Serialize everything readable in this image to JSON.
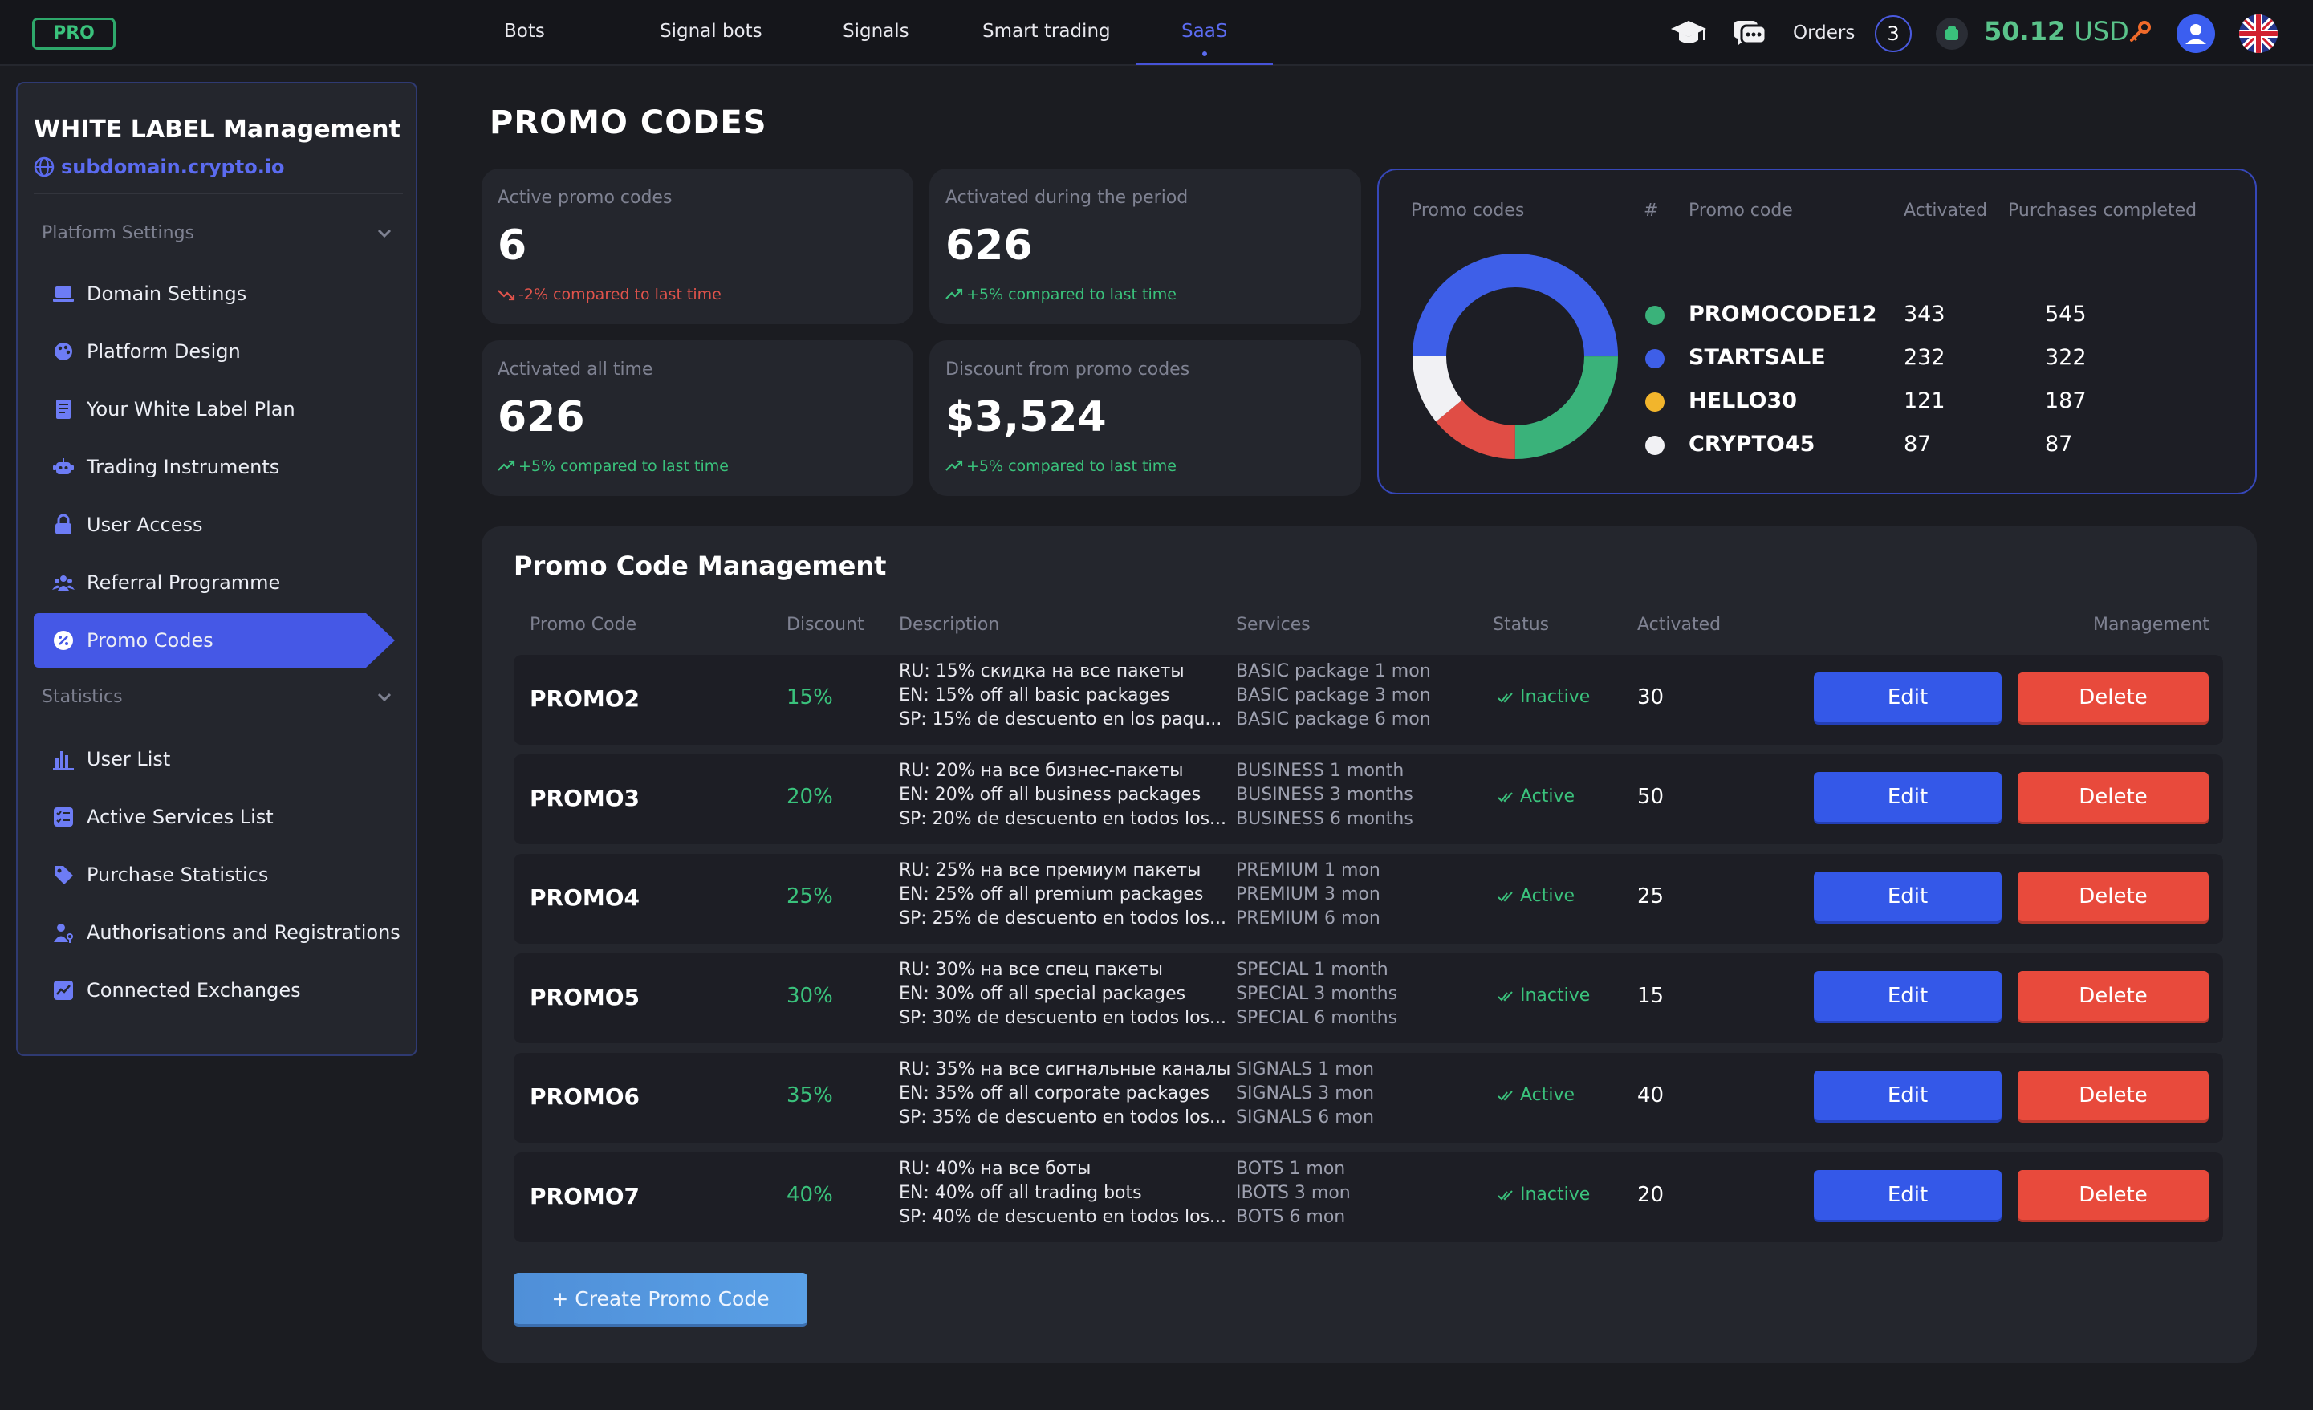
{
  "topbar": {
    "badge": "PRO",
    "nav": [
      {
        "label": "Bots"
      },
      {
        "label": "Signal bots"
      },
      {
        "label": "Signals"
      },
      {
        "label": "Smart trading"
      },
      {
        "label": "SaaS",
        "active": true
      }
    ],
    "orders_label": "Orders",
    "orders_count": "3",
    "balance": "50.12",
    "currency": "USD",
    "icons": [
      "graduation-cap-icon",
      "chat-icon",
      "wallet-icon",
      "key-icon",
      "user-avatar-icon",
      "uk-flag-icon"
    ]
  },
  "sidebar": {
    "title": "WHITE LABEL Management",
    "domain": "subdomain.crypto.io",
    "section_platform": "Platform Settings",
    "platform_items": [
      {
        "label": "Domain Settings",
        "icon": "laptop-icon"
      },
      {
        "label": "Platform Design",
        "icon": "palette-icon"
      },
      {
        "label": "Your White Label Plan",
        "icon": "document-icon"
      },
      {
        "label": "Trading Instruments",
        "icon": "robot-icon"
      },
      {
        "label": "User Access",
        "icon": "lock-icon"
      },
      {
        "label": "Referral Programme",
        "icon": "users-icon"
      },
      {
        "label": "Promo Codes",
        "icon": "percent-icon",
        "active": true
      }
    ],
    "section_stats": "Statistics",
    "stats_items": [
      {
        "label": "User List",
        "icon": "bar-chart-icon"
      },
      {
        "label": "Active Services List",
        "icon": "checklist-icon"
      },
      {
        "label": "Purchase Statistics",
        "icon": "tag-icon"
      },
      {
        "label": "Authorisations and Registrations",
        "icon": "user-key-icon"
      },
      {
        "label": "Connected Exchanges",
        "icon": "trend-icon"
      }
    ]
  },
  "page_title": "PROMO CODES",
  "stats": [
    {
      "label": "Active promo codes",
      "value": "6",
      "compare": "-2% compared to last time",
      "trend": "down"
    },
    {
      "label": "Activated during the period",
      "value": "626",
      "compare": "+5% compared to last time",
      "trend": "up"
    },
    {
      "label": "Activated all time",
      "value": "626",
      "compare": "+5% compared to last time",
      "trend": "up"
    },
    {
      "label": "Discount from promo codes",
      "value": "$3,524",
      "compare": "+5% compared to last time",
      "trend": "up"
    }
  ],
  "promo_summary": {
    "headers": {
      "title": "Promo codes",
      "num": "#",
      "code": "Promo code",
      "activated": "Activated",
      "purchases": "Purchases completed"
    },
    "rows": [
      {
        "name": "PROMOCODE12",
        "activated": "343",
        "purchases": "545",
        "color": "#3ab27a"
      },
      {
        "name": "STARTSALE",
        "activated": "232",
        "purchases": "322",
        "color": "#3e5fe8"
      },
      {
        "name": "HELLO30",
        "activated": "121",
        "purchases": "187",
        "color": "#f2b52c"
      },
      {
        "name": "CRYPTO45",
        "activated": "87",
        "purchases": "87",
        "color": "#f1f1f4"
      }
    ],
    "donut_segments": [
      {
        "color": "#3e5fe8",
        "fraction": 0.5
      },
      {
        "color": "#3ab27a",
        "fraction": 0.25
      },
      {
        "color": "#e04d45",
        "fraction": 0.14
      },
      {
        "color": "#f1f1f4",
        "fraction": 0.11
      }
    ]
  },
  "management": {
    "title": "Promo Code Management",
    "headers": {
      "code": "Promo Code",
      "discount": "Discount",
      "description": "Description",
      "services": "Services",
      "status": "Status",
      "activated": "Activated",
      "management": "Management"
    },
    "edit_label": "Edit",
    "delete_label": "Delete",
    "create_label": "+ Create Promo Code",
    "rows": [
      {
        "code": "PROMO2",
        "discount": "15%",
        "desc": [
          "RU: 15% скидка на все пакеты",
          "EN: 15% off all basic packages",
          "SP: 15% de descuento en  los paqu..."
        ],
        "services": [
          "BASIC package 1 mon",
          "BASIC package 3 mon",
          "BASIC package  6 mon"
        ],
        "status": "Inactive",
        "activated": "30"
      },
      {
        "code": "PROMO3",
        "discount": "20%",
        "desc": [
          "RU: 20%  на все бизнес-пакеты",
          "EN: 20% off all business packages",
          "SP: 20% de descuento en todos los..."
        ],
        "services": [
          "BUSINESS 1 month",
          "BUSINESS 3 months",
          "BUSINESS 6 months"
        ],
        "status": "Active",
        "activated": "50"
      },
      {
        "code": "PROMO4",
        "discount": "25%",
        "desc": [
          "RU: 25%  на все премиум пакеты",
          "EN: 25% off all premium packages",
          "SP: 25% de descuento en todos los..."
        ],
        "services": [
          "PREMIUM 1 mon",
          "PREMIUM 3 mon",
          "PREMIUM 6 mon"
        ],
        "status": "Active",
        "activated": "25"
      },
      {
        "code": "PROMO5",
        "discount": "30%",
        "desc": [
          "RU: 30%  на все спец пакеты",
          "EN: 30% off all special packages",
          "SP: 30% de descuento en todos los..."
        ],
        "services": [
          "SPECIAL 1 month",
          "SPECIAL 3 months",
          "SPECIAL 6 months"
        ],
        "status": "Inactive",
        "activated": "15"
      },
      {
        "code": "PROMO6",
        "discount": "35%",
        "desc": [
          "RU: 35% на все сигнальные каналы",
          "EN: 35% off all corporate packages",
          "SP: 35% de descuento en todos los..."
        ],
        "services": [
          "SIGNALS 1 mon",
          "SIGNALS 3 mon",
          "SIGNALS 6 mon"
        ],
        "status": "Active",
        "activated": "40"
      },
      {
        "code": "PROMO7",
        "discount": "40%",
        "desc": [
          "RU: 40%  на все боты",
          "EN: 40% off all trading bots",
          "SP: 40% de descuento en todos los..."
        ],
        "services": [
          "BOTS 1 mon",
          "IBOTS 3 mon",
          "BOTS 6 mon"
        ],
        "status": "Inactive",
        "activated": "20"
      }
    ]
  }
}
